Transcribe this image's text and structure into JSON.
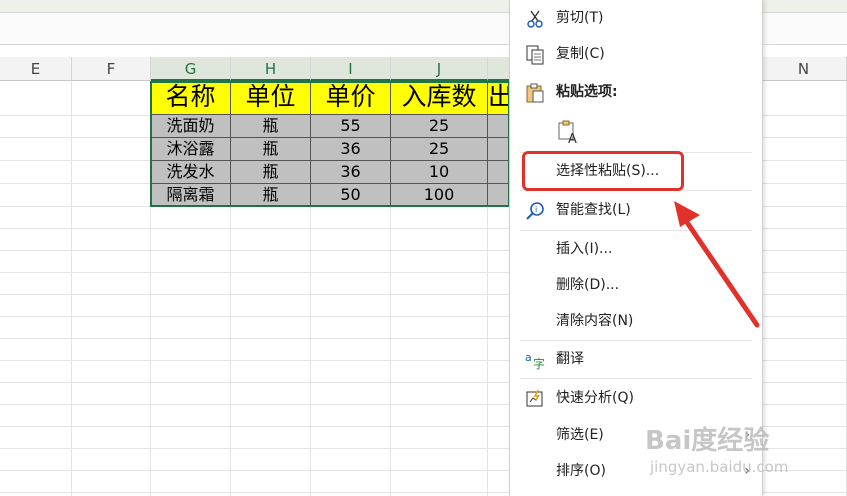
{
  "column_headers": [
    {
      "key": "E",
      "label": "E"
    },
    {
      "key": "F",
      "label": "F"
    },
    {
      "key": "G",
      "label": "G"
    },
    {
      "key": "H",
      "label": "H"
    },
    {
      "key": "I",
      "label": "I"
    },
    {
      "key": "J",
      "label": "J"
    },
    {
      "key": "N",
      "label": "N"
    }
  ],
  "table": {
    "headers": [
      "名称",
      "单位",
      "单价",
      "入库数",
      "出"
    ],
    "rows": [
      [
        "洗面奶",
        "瓶",
        "55",
        "25"
      ],
      [
        "沐浴露",
        "瓶",
        "36",
        "25"
      ],
      [
        "洗发水",
        "瓶",
        "36",
        "10"
      ],
      [
        "隔离霜",
        "瓶",
        "50",
        "100"
      ]
    ]
  },
  "context_menu": {
    "items": [
      {
        "label": "剪切(T)",
        "icon": "scissors-icon"
      },
      {
        "label": "复制(C)",
        "icon": "copy-icon"
      },
      {
        "label": "粘贴选项:",
        "icon": "clipboard-icon"
      },
      {
        "label": "",
        "icon": "paste-text-only-icon"
      },
      {
        "label": "选择性粘贴(S)...",
        "icon": ""
      },
      {
        "label": "智能查找(L)",
        "icon": "smart-lookup-icon"
      },
      {
        "label": "插入(I)...",
        "icon": ""
      },
      {
        "label": "删除(D)...",
        "icon": ""
      },
      {
        "label": "清除内容(N)",
        "icon": ""
      },
      {
        "label": "翻译",
        "icon": "translate-icon"
      },
      {
        "label": "快速分析(Q)",
        "icon": "quick-analysis-icon"
      },
      {
        "label": "筛选(E)",
        "icon": "",
        "submenu": true
      },
      {
        "label": "排序(O)",
        "icon": "",
        "submenu": true
      }
    ]
  },
  "submenu_arrow": "›",
  "watermark": {
    "main": "Bai度经验",
    "sub": "jingyan.baidu.com"
  },
  "colors": {
    "header_fill": "#ffff00",
    "data_fill": "#c0c0c0",
    "selection": "#217346",
    "highlight_box": "#e0322b",
    "arrow": "#e0322b"
  }
}
